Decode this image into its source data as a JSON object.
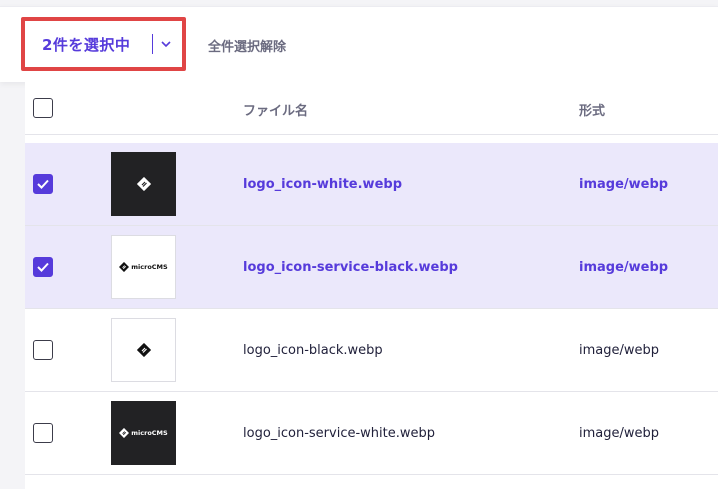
{
  "toolbar": {
    "selected_label": "2件を選択中",
    "clear_label": "全件選択解除"
  },
  "table": {
    "headers": {
      "filename": "ファイル名",
      "format": "形式"
    },
    "rows": [
      {
        "selected": true,
        "filename": "logo_icon-white.webp",
        "format": "image/webp",
        "thumb": "dark-icon"
      },
      {
        "selected": true,
        "filename": "logo_icon-service-black.webp",
        "format": "image/webp",
        "thumb": "light-wordmark",
        "logo_text": "microCMS"
      },
      {
        "selected": false,
        "filename": "logo_icon-black.webp",
        "format": "image/webp",
        "thumb": "light-icon"
      },
      {
        "selected": false,
        "filename": "logo_icon-service-white.webp",
        "format": "image/webp",
        "thumb": "dark-wordmark",
        "logo_text": "microCMS"
      }
    ]
  },
  "colors": {
    "accent": "#563bdb",
    "highlight": "#e04545",
    "selected_row": "#ebe8fb"
  }
}
